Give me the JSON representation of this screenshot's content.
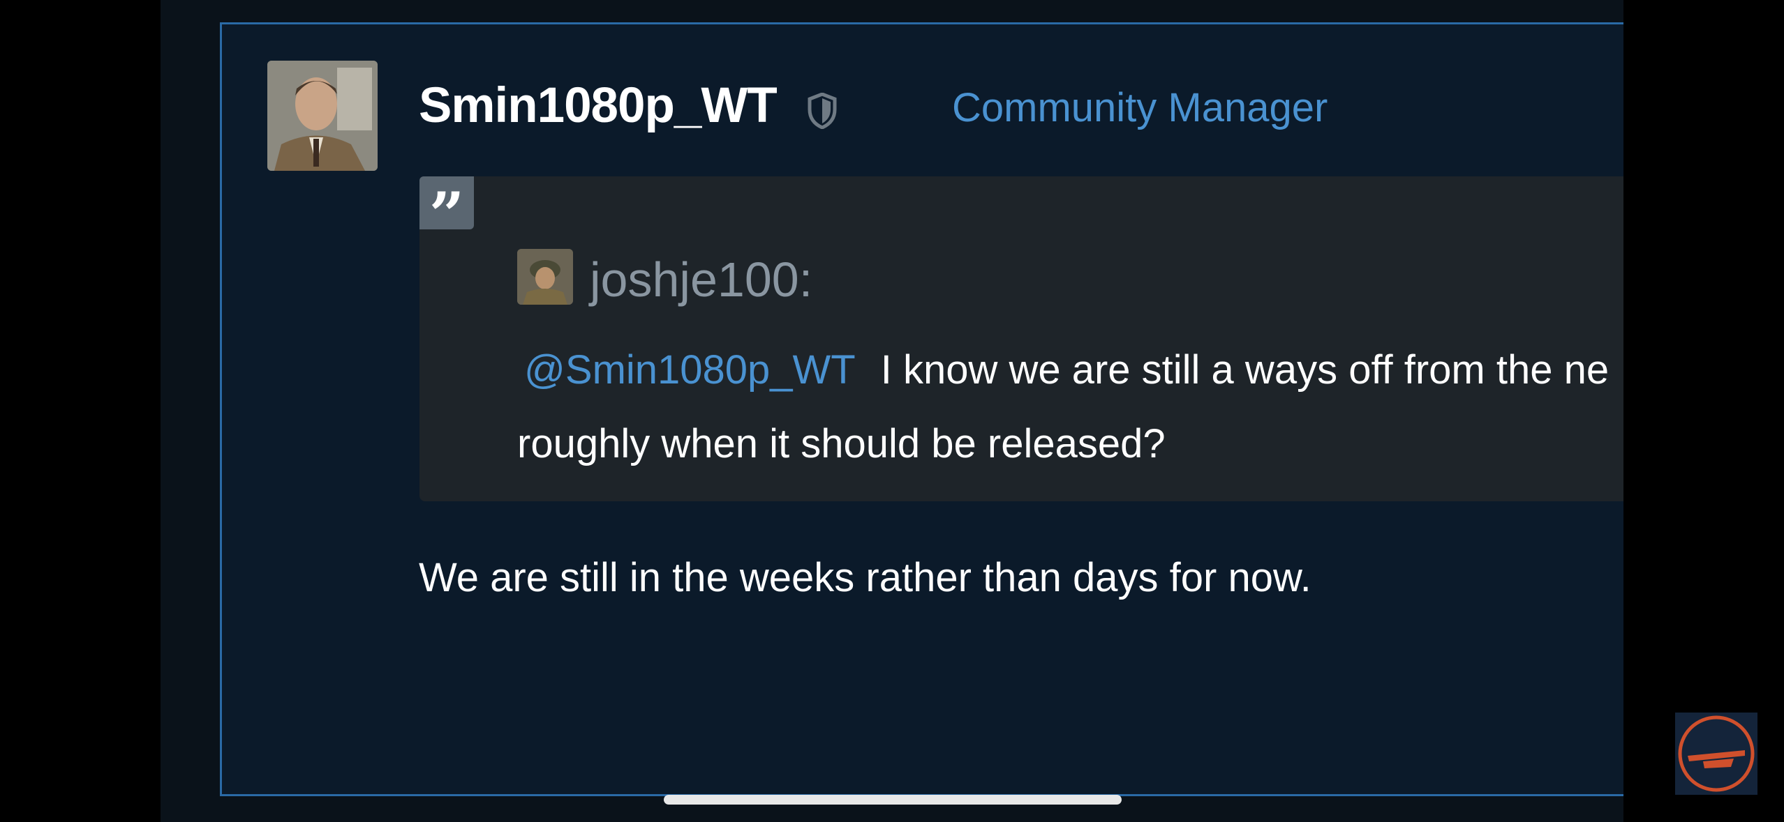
{
  "post": {
    "username": "Smin1080p_WT",
    "role": "Community Manager",
    "quote": {
      "username": "joshje100:",
      "mention": "@Smin1080p_WT",
      "line1": "I know we are still a ways off from the ne",
      "line2": "roughly when it should be released?"
    },
    "reply": "We are still in the weeks rather than days for now."
  },
  "icons": [
    "shield-icon",
    "quote-icon",
    "avatar",
    "channel-logo"
  ],
  "colors": {
    "role": "#4a92d1",
    "post_bg": "#0b1a2a",
    "quote_bg": "#1e2429",
    "border": "#2a6aa6"
  }
}
